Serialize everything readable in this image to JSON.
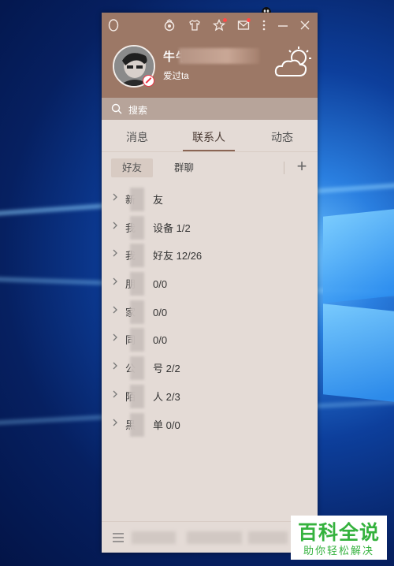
{
  "desktop": {
    "accent": "#0d3f9c"
  },
  "titlebar": {
    "icons": [
      "qq-penguin-icon",
      "medal-icon",
      "shirt-icon",
      "star-icon",
      "mail-icon",
      "more-icon",
      "minimize-icon",
      "close-icon"
    ]
  },
  "profile": {
    "nickname": "牛牛",
    "signature": "爱过ta",
    "status": "do-not-disturb"
  },
  "search": {
    "placeholder": "搜索"
  },
  "tabs": [
    {
      "label": "消息"
    },
    {
      "label": "联系人",
      "active": true
    },
    {
      "label": "动态"
    }
  ],
  "contacts": {
    "filters": [
      {
        "label": "好友",
        "active": true
      },
      {
        "label": "群聊"
      }
    ],
    "add_label": "+",
    "groups": [
      {
        "prefix": "新",
        "suffix": "友"
      },
      {
        "prefix": "我",
        "suffix": "设备 1/2"
      },
      {
        "prefix": "我",
        "suffix": "好友 12/26"
      },
      {
        "prefix": "朋",
        "suffix": "0/0"
      },
      {
        "prefix": "家",
        "suffix": "0/0"
      },
      {
        "prefix": "同",
        "suffix": "0/0"
      },
      {
        "prefix": "公",
        "suffix": "号 2/2"
      },
      {
        "prefix": "陌",
        "suffix": "人 2/3"
      },
      {
        "prefix": "黑",
        "suffix": "单 0/0"
      }
    ]
  },
  "watermark": {
    "main": "百科全说",
    "sub": "助你轻松解决"
  },
  "colors": {
    "header": "#9c7866",
    "body": "#e4dbd6",
    "watermark": "#35b23e"
  }
}
